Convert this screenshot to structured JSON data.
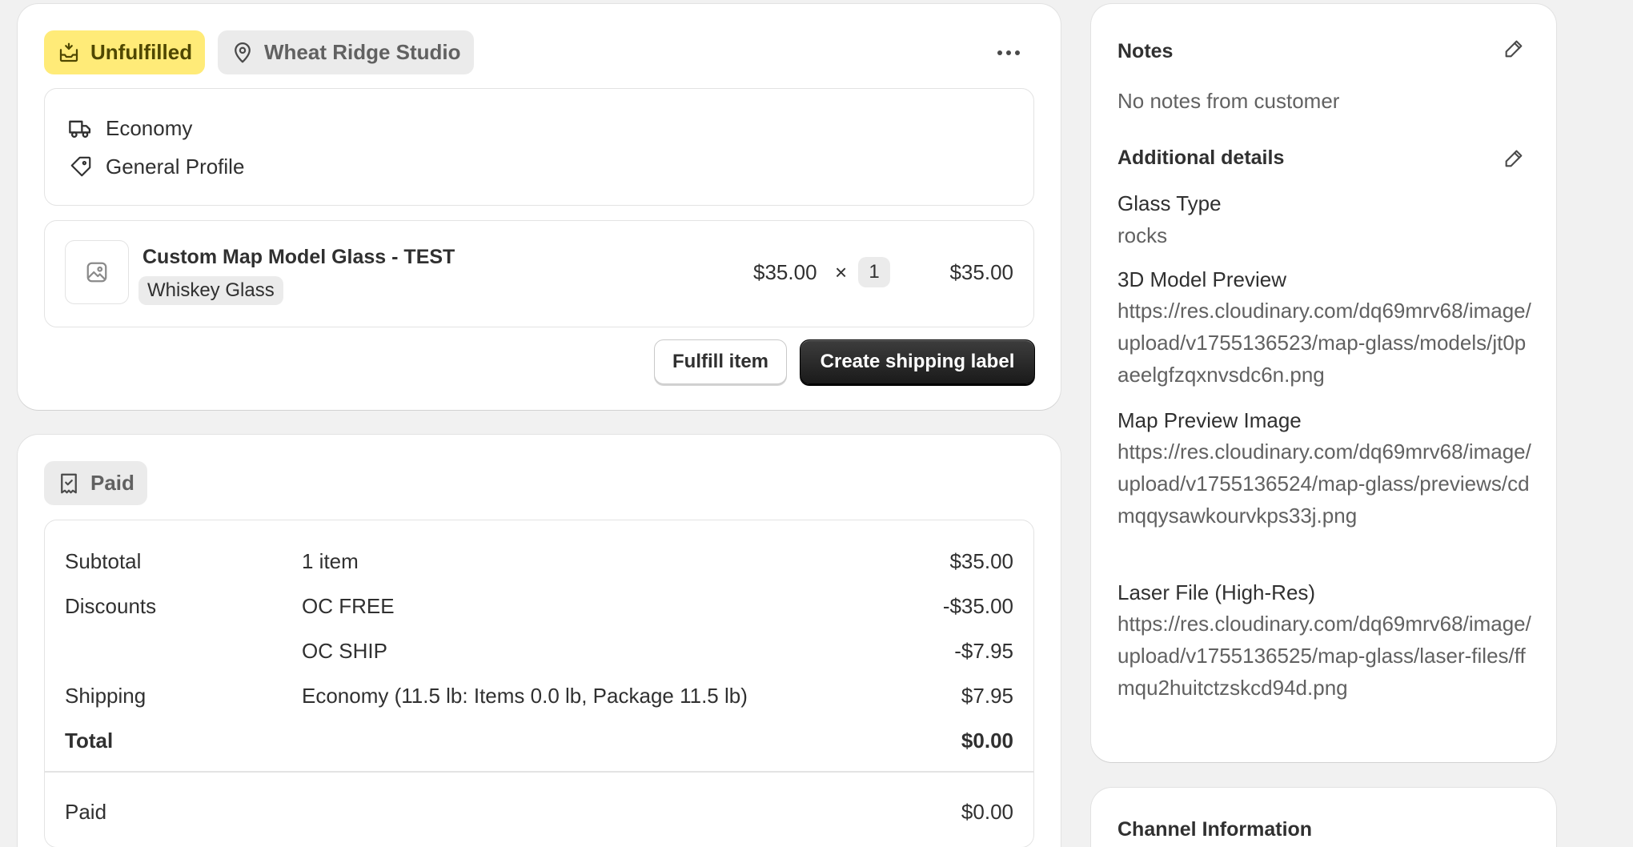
{
  "fulfillment": {
    "status_badge": "Unfulfilled",
    "location_badge": "Wheat Ridge Studio",
    "shipping_method": "Economy",
    "shipping_profile": "General Profile",
    "item": {
      "title": "Custom Map Model Glass - TEST",
      "variant": "Whiskey Glass",
      "unit_price": "$35.00",
      "times": "×",
      "quantity": "1",
      "line_total": "$35.00"
    },
    "fulfill_button": "Fulfill item",
    "create_label_button": "Create shipping label"
  },
  "payment": {
    "status_badge": "Paid",
    "rows": {
      "subtotal": {
        "label": "Subtotal",
        "detail": "1 item",
        "amount": "$35.00"
      },
      "discounts": {
        "label": "Discounts",
        "detail": "OC FREE",
        "amount": "-$35.00"
      },
      "discount2": {
        "detail": "OC SHIP",
        "amount": "-$7.95"
      },
      "shipping": {
        "label": "Shipping",
        "detail": "Economy (11.5 lb: Items 0.0 lb, Package 11.5 lb)",
        "amount": "$7.95"
      },
      "total": {
        "label": "Total",
        "amount": "$0.00"
      },
      "paid": {
        "label": "Paid",
        "amount": "$0.00"
      }
    }
  },
  "notes": {
    "title": "Notes",
    "body": "No notes from customer",
    "additional_title": "Additional details",
    "fields": [
      {
        "label": "Glass Type",
        "value": "rocks"
      },
      {
        "label": "3D Model Preview",
        "value": "https://res.cloudinary.com/dq69mrv68/image/upload/v1755136523/map-glass/models/jt0paeelgfzqxnvsdc6n.png"
      },
      {
        "label": "Map Preview Image",
        "value": "https://res.cloudinary.com/dq69mrv68/image/upload/v1755136524/map-glass/previews/cdmqqysawkourvkps33j.png"
      },
      {
        "label": "Laser File (High-Res)",
        "value": "https://res.cloudinary.com/dq69mrv68/image/upload/v1755136525/map-glass/laser-files/ffmqu2huitctzskcd94d.png"
      }
    ]
  },
  "channel": {
    "title": "Channel Information"
  },
  "colors": {
    "unfulfilled_bg": "#ffeb78",
    "unfulfilled_fg": "#4f4700",
    "neutral_badge_bg": "#ebebeb",
    "primary_button": "#303030"
  },
  "icons": {
    "unfulfilled": "inbox-icon",
    "location": "location-pin-icon",
    "more": "more-horizontal-icon",
    "shipping": "truck-icon",
    "profile": "tag-icon",
    "image": "image-placeholder-icon",
    "paid": "receipt-check-icon",
    "edit": "pencil-icon"
  }
}
